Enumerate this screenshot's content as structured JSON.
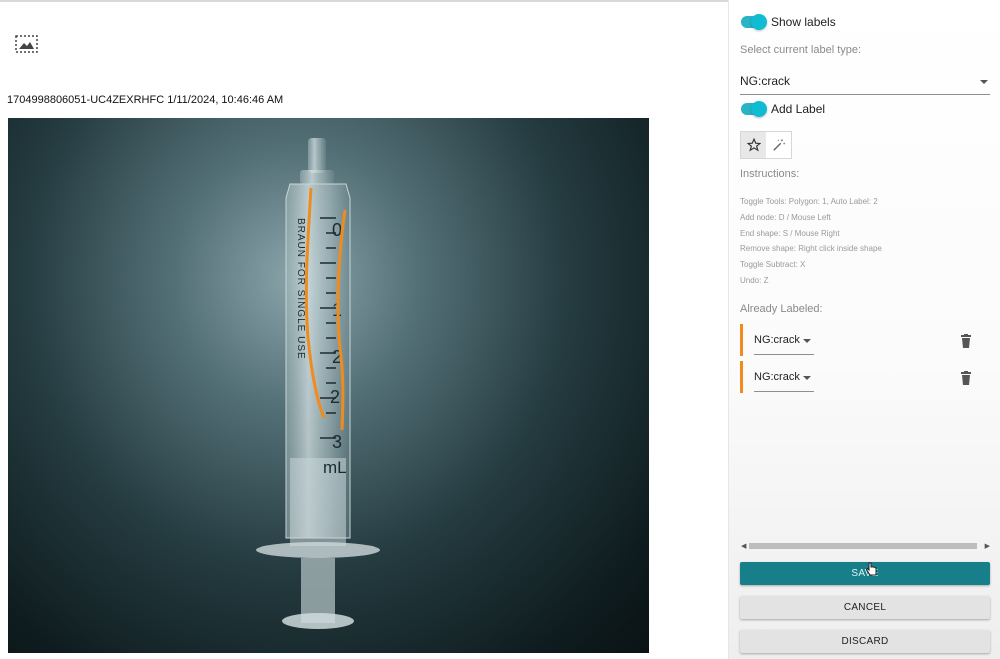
{
  "caption": {
    "image_id_timestamp": "1704998806051-UC4ZEXRHFC 1/11/2024, 10:46:46 AM"
  },
  "icons": {
    "image_placeholder": "image-icon",
    "polygon_tool": "star-icon",
    "auto_label_tool": "magic-wand-icon",
    "delete": "trash-icon"
  },
  "panel": {
    "show_labels": {
      "label": "Show labels",
      "on": true
    },
    "select_label_prompt": "Select current label type:",
    "current_label_type": "NG:crack",
    "add_label": {
      "label": "Add Label",
      "on": true
    },
    "instructions_title": "Instructions:",
    "instructions": [
      "Toggle Tools: Polygon: 1, Auto Label: 2",
      "Add node: D / Mouse Left",
      "End shape: S / Mouse Right",
      "Remove shape: Right click inside shape",
      "Toggle Subtract: X",
      "Undo: Z"
    ],
    "already_labeled_title": "Already Labeled:",
    "labeled_items": [
      {
        "label": "NG:crack",
        "color": "#f08c1e"
      },
      {
        "label": "NG:crack",
        "color": "#f08c1e"
      }
    ],
    "buttons": {
      "save": "SAVE",
      "cancel": "CANCEL",
      "discard": "DISCARD"
    }
  },
  "colors": {
    "accent": "#177f8a",
    "toggle": "#10bcd2",
    "label_orange": "#f08c1e"
  }
}
